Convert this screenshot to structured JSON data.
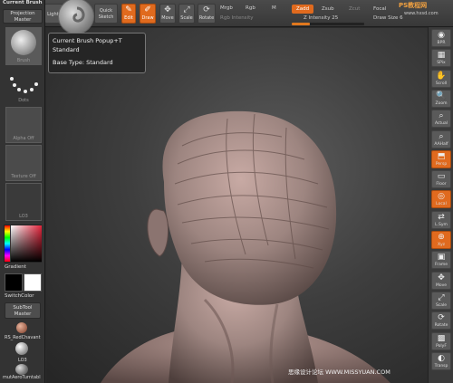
{
  "colors": {
    "accent": "#e06a1e",
    "panel": "#333333",
    "topbar": "#404040",
    "viewport_center": "#5c5c5c",
    "clay": "#9d8580"
  },
  "topbar": {
    "current_brush_label": "Current Brush",
    "lightbox_label": "LightBox",
    "quick_sketch_label": "Quick Sketch",
    "edit_label": "Edit",
    "draw_label": "Draw",
    "move_label": "Move",
    "scale_label": "Scale",
    "rotate_label": "Rotate",
    "mrgb_label": "Mrgb",
    "rgb_label": "Rgb",
    "m_label": "M",
    "rgb_intensity_label": "Rgb Intensity",
    "zadd_label": "Zadd",
    "zsub_label": "Zsub",
    "zcut_label": "Zcut",
    "z_intensity_label": "Z Intensity 25",
    "focal_label": "Focal",
    "draw_size_label": "Draw Size 6",
    "z_intensity_value": 0.25
  },
  "left_shelf": {
    "projection_master": "Projection Master",
    "brush_caption": "Brush",
    "dots_caption": "Dots",
    "alpha_caption": "Alpha Off",
    "texture_caption": "Texture Off",
    "material_caption": "LO3",
    "gradient_label": "Gradient",
    "switch_color_label": "SwitchColor",
    "subtool_master": "SubTool Master",
    "material_1": "RS_RedChavant",
    "material_2": "LO3",
    "material_3": "mutAeroTurntabl"
  },
  "right_shelf": {
    "items": [
      {
        "label": "BPR",
        "icon": "render-icon"
      },
      {
        "label": "SPix",
        "icon": "spix-icon"
      },
      {
        "label": "Scroll",
        "icon": "scroll-hand-icon"
      },
      {
        "label": "Zoom",
        "icon": "zoom-icon"
      },
      {
        "label": "Actual",
        "icon": "actual-size-icon"
      },
      {
        "label": "AAHalf",
        "icon": "aahalf-icon"
      },
      {
        "label": "Persp",
        "icon": "perspective-icon"
      },
      {
        "label": "Floor",
        "icon": "floor-icon"
      },
      {
        "label": "Local",
        "icon": "local-icon"
      },
      {
        "label": "L.Sym",
        "icon": "symmetry-icon"
      },
      {
        "label": "Xyz",
        "icon": "xyz-icon"
      },
      {
        "label": "Frame",
        "icon": "frame-icon"
      },
      {
        "label": "Move",
        "icon": "move-icon"
      },
      {
        "label": "Scale",
        "icon": "scale-icon"
      },
      {
        "label": "Rotate",
        "icon": "rotate-icon"
      },
      {
        "label": "PolyF",
        "icon": "polyframe-icon"
      },
      {
        "label": "Transp",
        "icon": "transparency-icon"
      }
    ]
  },
  "tooltip": {
    "line1": "Current Brush  Popup+T",
    "line2": "Standard",
    "line3": "Base Type: Standard"
  },
  "watermarks": {
    "top_right": "PS教程网",
    "top_right_url": "www.hxsd.com",
    "bottom_right": "思缘设计论坛 WWW.MISSYUAN.COM"
  }
}
